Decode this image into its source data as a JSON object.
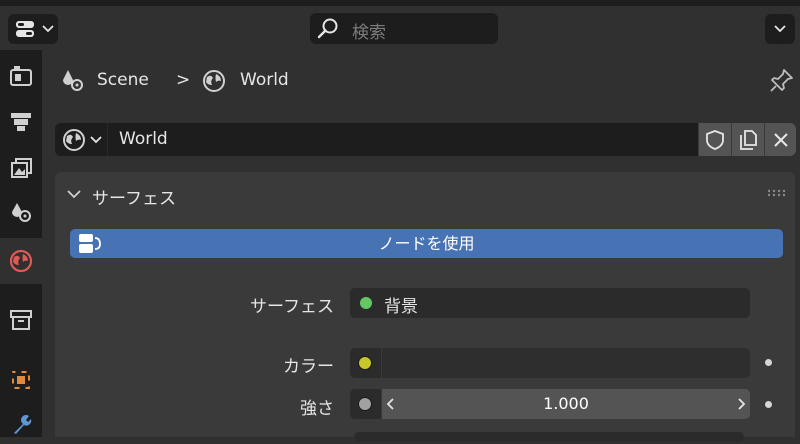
{
  "header": {
    "search_placeholder": "検索"
  },
  "breadcrumb": {
    "scene": "Scene",
    "separator": ">",
    "world": "World"
  },
  "datablock": {
    "name": "World"
  },
  "surface_panel": {
    "title": "サーフェス",
    "use_nodes_label": "ノードを使用",
    "surface_label": "サーフェス",
    "surface_value": "背景",
    "color_label": "カラー",
    "strength_label": "強さ",
    "strength_value": "1.000"
  },
  "colors": {
    "accent": "#4772b3",
    "active_tab_icon": "#e05a55",
    "surface_socket": "#63c763",
    "color_socket": "#c7c729",
    "strength_socket": "#a1a1a1"
  },
  "icons": {
    "sidebar": [
      "tool-icon",
      "render-icon",
      "output-icon",
      "view-layer-icon",
      "scene-icon",
      "world-icon",
      "collection-icon",
      "object-icon",
      "modifier-icon"
    ]
  }
}
